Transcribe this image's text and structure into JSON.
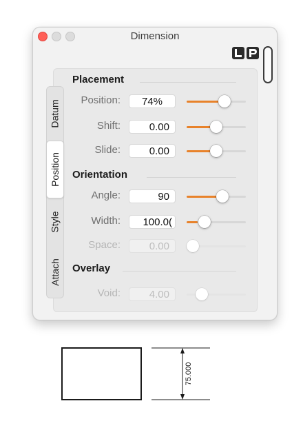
{
  "window": {
    "title": "Dimension"
  },
  "tabs": [
    "Datum",
    "Position",
    "Style",
    "Attach"
  ],
  "active_tab": "Position",
  "sections": {
    "placement": "Placement",
    "orientation": "Orientation",
    "overlay": "Overlay"
  },
  "fields": {
    "position": {
      "label": "Position:",
      "value": "74%",
      "slider": 0.65
    },
    "shift": {
      "label": "Shift:",
      "value": "0.00",
      "slider": 0.5
    },
    "slide": {
      "label": "Slide:",
      "value": "0.00",
      "slider": 0.5
    },
    "angle": {
      "label": "Angle:",
      "value": "90",
      "slider": 0.6
    },
    "width": {
      "label": "Width:",
      "value": "100.0(",
      "slider": 0.15
    },
    "space": {
      "label": "Space:",
      "value": "0.00",
      "slider": 0.0
    },
    "void": {
      "label": "Void:",
      "value": "4.00",
      "slider": 0.1
    }
  },
  "drawing": {
    "dimension_text": "75.000"
  },
  "colors": {
    "accent": "#e8822a",
    "close": "#ff5f57"
  }
}
